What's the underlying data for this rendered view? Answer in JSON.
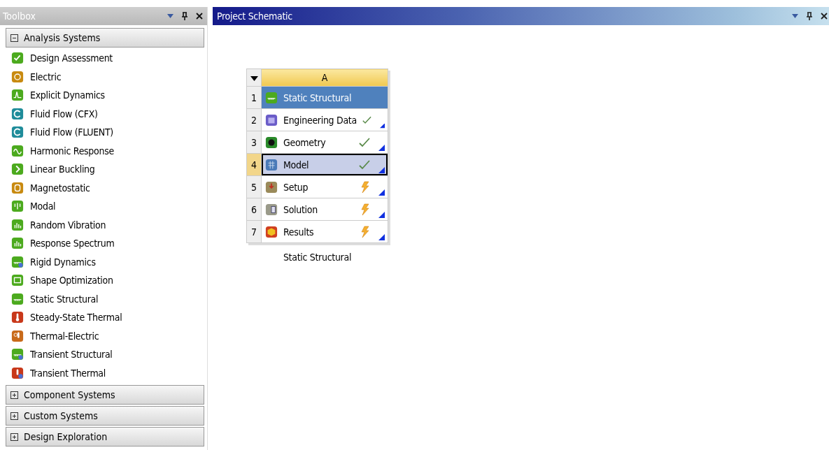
{
  "toolbox": {
    "title": "Toolbox",
    "groups": [
      {
        "label": "Analysis Systems",
        "expanded": true,
        "items": [
          {
            "label": "Design Assessment"
          },
          {
            "label": "Electric"
          },
          {
            "label": "Explicit Dynamics"
          },
          {
            "label": "Fluid Flow (CFX)"
          },
          {
            "label": "Fluid Flow (FLUENT)"
          },
          {
            "label": "Harmonic Response"
          },
          {
            "label": "Linear Buckling"
          },
          {
            "label": "Magnetostatic"
          },
          {
            "label": "Modal"
          },
          {
            "label": "Random Vibration"
          },
          {
            "label": "Response Spectrum"
          },
          {
            "label": "Rigid Dynamics"
          },
          {
            "label": "Shape Optimization"
          },
          {
            "label": "Static Structural"
          },
          {
            "label": "Steady-State Thermal"
          },
          {
            "label": "Thermal-Electric"
          },
          {
            "label": "Transient Structural"
          },
          {
            "label": "Transient Thermal"
          }
        ]
      },
      {
        "label": "Component Systems",
        "expanded": false
      },
      {
        "label": "Custom Systems",
        "expanded": false
      },
      {
        "label": "Design Exploration",
        "expanded": false
      }
    ]
  },
  "schematic": {
    "title": "Project Schematic",
    "system": {
      "column": "A",
      "caption": "Static Structural",
      "rows": [
        {
          "number": "1",
          "label": "Static Structural",
          "kind": "title",
          "selected": false
        },
        {
          "number": "2",
          "label": "Engineering Data",
          "kind": "done",
          "selected": false
        },
        {
          "number": "3",
          "label": "Geometry",
          "kind": "done",
          "selected": false
        },
        {
          "number": "4",
          "label": "Model",
          "kind": "done",
          "selected": true
        },
        {
          "number": "5",
          "label": "Setup",
          "kind": "pending",
          "selected": false
        },
        {
          "number": "6",
          "label": "Solution",
          "kind": "pending",
          "selected": false
        },
        {
          "number": "7",
          "label": "Results",
          "kind": "pending",
          "selected": false
        }
      ]
    }
  }
}
